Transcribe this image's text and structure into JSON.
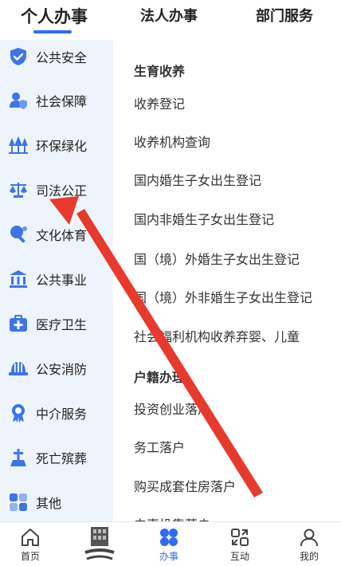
{
  "top_tabs": [
    {
      "label": "个人办事",
      "active": true
    },
    {
      "label": "法人办事",
      "active": false
    },
    {
      "label": "部门服务",
      "active": false
    }
  ],
  "sidebar": {
    "items": [
      {
        "label": "公共安全",
        "icon": "shield-check-icon"
      },
      {
        "label": "社会保障",
        "icon": "person-shield-icon"
      },
      {
        "label": "环保绿化",
        "icon": "trees-icon"
      },
      {
        "label": "司法公正",
        "icon": "scales-icon"
      },
      {
        "label": "文化体育",
        "icon": "ping-pong-icon"
      },
      {
        "label": "公共事业",
        "icon": "institution-icon"
      },
      {
        "label": "医疗卫生",
        "icon": "medical-kit-icon"
      },
      {
        "label": "公安消防",
        "icon": "fire-helmet-icon"
      },
      {
        "label": "中介服务",
        "icon": "award-badge-icon"
      },
      {
        "label": "死亡殡葬",
        "icon": "cross-monument-icon"
      },
      {
        "label": "其他",
        "icon": "grid-apps-icon"
      }
    ]
  },
  "content": {
    "sections": [
      {
        "title": "生育收养",
        "items": [
          "收养登记",
          "收养机构查询",
          "国内婚生子女出生登记",
          "国内非婚生子女出生登记",
          "国（境）外婚生子女出生登记",
          "国（境）外非婚生子女出生登记",
          "社会福利机构收养弃婴、儿童"
        ]
      },
      {
        "title": "户籍办理",
        "items": [
          "投资创业落户",
          "务工落户",
          "购买成套住房落户",
          "夫妻投靠落户"
        ]
      }
    ]
  },
  "bottom_nav": [
    {
      "label": "首页",
      "icon": "home-icon",
      "active": false
    },
    {
      "label": "",
      "icon": "yukuaiban-logo-icon",
      "active": false
    },
    {
      "label": "办事",
      "icon": "apps-icon",
      "active": true
    },
    {
      "label": "互动",
      "icon": "interaction-icon",
      "active": false
    },
    {
      "label": "我的",
      "icon": "user-icon",
      "active": false
    }
  ],
  "colors": {
    "accent": "#2f6bf2",
    "sidebar_bg": "#eef4fc",
    "annotation": "#e8392e"
  }
}
